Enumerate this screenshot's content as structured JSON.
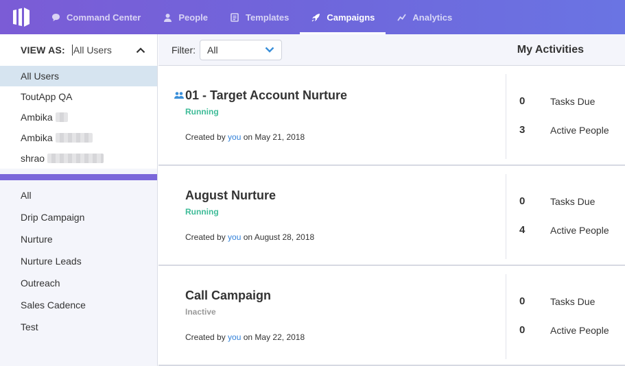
{
  "nav": {
    "items": [
      {
        "label": "Command Center",
        "icon": "chat-bubble-icon",
        "active": false
      },
      {
        "label": "People",
        "icon": "person-icon",
        "active": false
      },
      {
        "label": "Templates",
        "icon": "document-icon",
        "active": false
      },
      {
        "label": "Campaigns",
        "icon": "rocket-icon",
        "active": true
      },
      {
        "label": "Analytics",
        "icon": "line-chart-icon",
        "active": false
      }
    ]
  },
  "sidebar": {
    "view_as_label": "VIEW AS:",
    "view_as_value": "All Users",
    "users": [
      {
        "name": "All Users"
      },
      {
        "name": "ToutApp QA"
      },
      {
        "name": "Ambika"
      },
      {
        "name": "Ambika"
      },
      {
        "name": "shrao"
      }
    ],
    "categories": [
      "All",
      "Drip Campaign",
      "Nurture",
      "Nurture Leads",
      "Outreach",
      "Sales Cadence",
      "Test"
    ]
  },
  "filter": {
    "label": "Filter:",
    "value": "All"
  },
  "my_activities_label": "My Activities",
  "created_by_prefix": "Created by",
  "created_by_user": "you",
  "tasks_due_label": "Tasks Due",
  "active_people_label": "Active People",
  "campaigns": [
    {
      "title": "01 - Target Account Nurture",
      "status": "Running",
      "date_text": "on May 21, 2018",
      "tasks_due": "0",
      "active_people": "3"
    },
    {
      "title": "August Nurture",
      "status": "Running",
      "date_text": "on August 28, 2018",
      "tasks_due": "0",
      "active_people": "4"
    },
    {
      "title": "Call Campaign",
      "status": "Inactive",
      "date_text": "on May 22, 2018",
      "tasks_due": "0",
      "active_people": "0"
    }
  ],
  "colors": {
    "accent": "#7b67da",
    "running": "#3dbb97",
    "link": "#2f7fd8",
    "selected_row": "#d6e4f0"
  }
}
